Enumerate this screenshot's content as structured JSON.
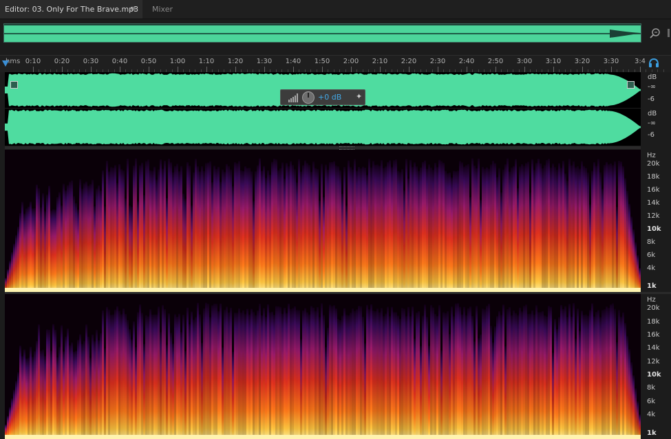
{
  "tabs": {
    "editor_label": "Editor: 03. Only For The Brave.mp3",
    "menu_glyph": "≡",
    "mixer_label": "Mixer"
  },
  "icons": {
    "zoom": "zoom-icon",
    "headphones": "headphones-icon",
    "pin": "pin-icon",
    "volume_knob": "knob-icon"
  },
  "ruler": {
    "unit": "hms",
    "ticks": [
      "0:10",
      "0:20",
      "0:30",
      "0:40",
      "0:50",
      "1:00",
      "1:10",
      "1:20",
      "1:30",
      "1:40",
      "1:50",
      "2:00",
      "2:10",
      "2:20",
      "2:30",
      "2:40",
      "2:50",
      "3:00",
      "3:10",
      "3:20",
      "3:30",
      "3:4"
    ]
  },
  "amplitude_ruler": {
    "ch1": {
      "db": "dB",
      "inf": "-∞",
      "six": "-6"
    },
    "ch2": {
      "db": "dB",
      "inf": "-∞",
      "six": "-6"
    }
  },
  "hud": {
    "value": "+0 dB",
    "pin_glyph": "✦"
  },
  "freq_axis": {
    "unit": "Hz",
    "labels": [
      "20k",
      "18k",
      "16k",
      "14k",
      "12k",
      "10k",
      "8k",
      "6k",
      "4k",
      "1k"
    ]
  },
  "colors": {
    "waveform": "#4fdca0",
    "accent": "#3b8fd6",
    "hud_value": "#43a8e6"
  }
}
